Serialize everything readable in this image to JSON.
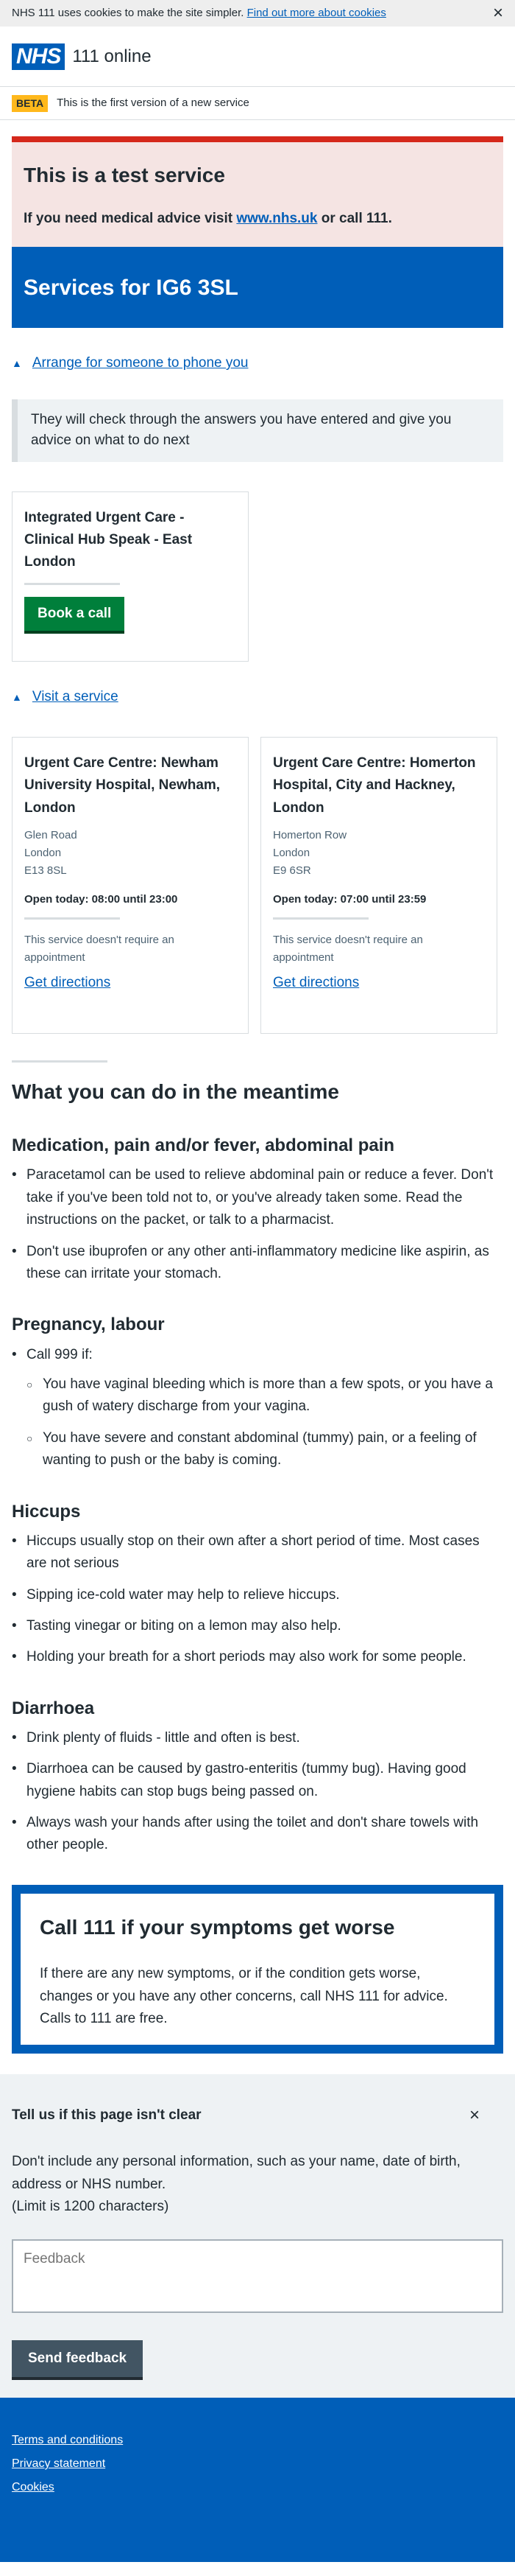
{
  "cookie_banner": {
    "text": "NHS 111 uses cookies to make the site simpler.",
    "link": "Find out more about cookies",
    "close": "×"
  },
  "header": {
    "logo": "NHS",
    "service": "111 online"
  },
  "beta": {
    "tag": "BETA",
    "text": "This is the first version of a new service"
  },
  "test_warning": {
    "title": "This is a test service",
    "text_before": "If you need medical advice visit ",
    "link": "www.nhs.uk",
    "text_after": " or call 111."
  },
  "services_title": "Services for IG6 3SL",
  "phone_section": {
    "toggle": "Arrange for someone to phone you",
    "inset": "They will check through the answers you have entered and give you advice on what to do next",
    "card_title": "Integrated Urgent Care - Clinical Hub Speak - East London",
    "button": "Book a call"
  },
  "visit_section": {
    "toggle": "Visit a service",
    "cards": [
      {
        "title": "Urgent Care Centre: Newham University Hospital, Newham, London",
        "address": [
          "Glen Road",
          "London",
          "E13 8SL"
        ],
        "open": "Open today: 08:00 until 23:00",
        "note": "This service doesn't require an appointment",
        "link": "Get directions"
      },
      {
        "title": "Urgent Care Centre: Homerton Hospital, City and Hackney, London",
        "address": [
          "Homerton Row",
          "London",
          "E9 6SR"
        ],
        "open": "Open today: 07:00 until 23:59",
        "note": "This service doesn't require an appointment",
        "link": "Get directions"
      }
    ]
  },
  "meantime": {
    "title": "What you can do in the meantime",
    "sections": [
      {
        "title": "Medication, pain and/or fever, abdominal pain",
        "items": [
          "Paracetamol can be used to relieve abdominal pain or reduce a fever. Don't take if you've been told not to, or you've already taken some. Read the instructions on the packet, or talk to a pharmacist.",
          "Don't use ibuprofen or any other anti-inflammatory medicine like aspirin, as these can irritate your stomach."
        ]
      },
      {
        "title": "Pregnancy, labour",
        "items": [
          "Call 999 if:"
        ],
        "subitems": [
          "You have vaginal bleeding which is more than a few spots, or you have a gush of watery discharge from your vagina.",
          "You have severe and constant abdominal (tummy) pain, or a feeling of wanting to push or the baby is coming."
        ]
      },
      {
        "title": "Hiccups",
        "items": [
          "Hiccups usually stop on their own after a short period of time. Most cases are not serious",
          "Sipping ice-cold water may help to relieve hiccups.",
          "Tasting vinegar or biting on a lemon may also help.",
          "Holding your breath for a short periods may also work for some people."
        ]
      },
      {
        "title": "Diarrhoea",
        "items": [
          "Drink plenty of fluids - little and often is best.",
          "Diarrhoea can be caused by gastro-enteritis (tummy bug). Having good hygiene habits can stop bugs being passed on.",
          "Always wash your hands after using the toilet and don't share towels with other people."
        ]
      }
    ]
  },
  "care_card": {
    "title": "Call 111 if your symptoms get worse",
    "text": "If there are any new symptoms, or if the condition gets worse, changes or you have any other concerns, call NHS 111 for advice. Calls to 111 are free."
  },
  "feedback": {
    "title": "Tell us if this page isn't clear",
    "close": "×",
    "text": "Don't include any personal information, such as your name, date of birth, address or NHS number.",
    "limit": "(Limit is 1200 characters)",
    "placeholder": "Feedback",
    "button": "Send feedback"
  },
  "footer": {
    "links": [
      "Terms and conditions",
      "Privacy statement",
      "Cookies"
    ]
  },
  "colors": {
    "nhs_blue": "#005eb8",
    "green": "#007f3b",
    "red": "#d5281b",
    "yellow": "#ffb81c"
  }
}
